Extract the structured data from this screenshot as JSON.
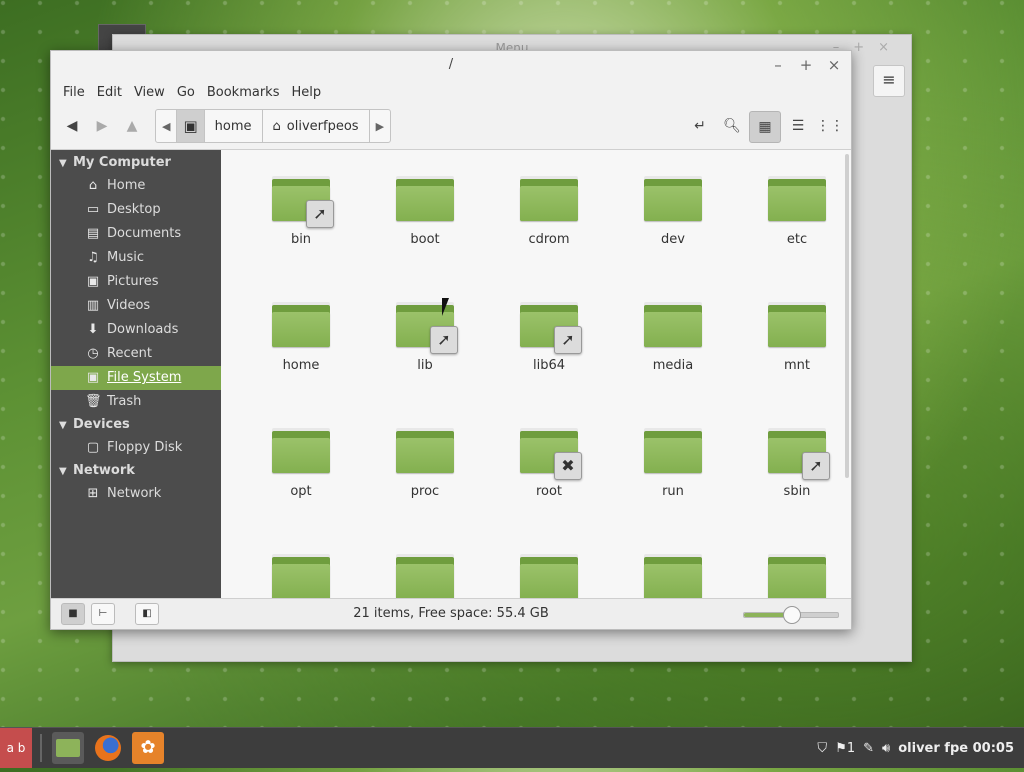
{
  "background_window": {
    "title": "Menu",
    "menu_icon": "hamburger-icon"
  },
  "window": {
    "title": "/",
    "controls": [
      "–",
      "+",
      "×"
    ]
  },
  "menubar": [
    "File",
    "Edit",
    "View",
    "Go",
    "Bookmarks",
    "Help"
  ],
  "toolbar": {
    "breadcrumbs": [
      "home",
      "oliverfpeos"
    ],
    "view_buttons": [
      "icon-view",
      "list-view",
      "compact-view"
    ],
    "active_view": "icon-view"
  },
  "sidebar": {
    "sections": [
      {
        "title": "My Computer",
        "items": [
          {
            "label": "Home",
            "icon": "home-icon"
          },
          {
            "label": "Desktop",
            "icon": "desktop-icon"
          },
          {
            "label": "Documents",
            "icon": "documents-icon"
          },
          {
            "label": "Music",
            "icon": "music-icon"
          },
          {
            "label": "Pictures",
            "icon": "pictures-icon"
          },
          {
            "label": "Videos",
            "icon": "videos-icon"
          },
          {
            "label": "Downloads",
            "icon": "downloads-icon"
          },
          {
            "label": "Recent",
            "icon": "recent-icon"
          },
          {
            "label": "File System",
            "icon": "filesystem-icon",
            "selected": true
          },
          {
            "label": "Trash",
            "icon": "trash-icon"
          }
        ]
      },
      {
        "title": "Devices",
        "items": [
          {
            "label": "Floppy Disk",
            "icon": "floppy-icon"
          }
        ]
      },
      {
        "title": "Network",
        "items": [
          {
            "label": "Network",
            "icon": "network-icon"
          }
        ]
      }
    ]
  },
  "files": [
    {
      "name": "bin",
      "emblem": "symlink"
    },
    {
      "name": "boot",
      "emblem": ""
    },
    {
      "name": "cdrom",
      "emblem": ""
    },
    {
      "name": "dev",
      "emblem": ""
    },
    {
      "name": "etc",
      "emblem": ""
    },
    {
      "name": "home",
      "emblem": ""
    },
    {
      "name": "lib",
      "emblem": "symlink"
    },
    {
      "name": "lib64",
      "emblem": "symlink"
    },
    {
      "name": "media",
      "emblem": ""
    },
    {
      "name": "mnt",
      "emblem": ""
    },
    {
      "name": "opt",
      "emblem": ""
    },
    {
      "name": "proc",
      "emblem": ""
    },
    {
      "name": "root",
      "emblem": "unreadable"
    },
    {
      "name": "run",
      "emblem": ""
    },
    {
      "name": "sbin",
      "emblem": "symlink"
    },
    {
      "name": "",
      "emblem": ""
    },
    {
      "name": "",
      "emblem": ""
    },
    {
      "name": "",
      "emblem": ""
    },
    {
      "name": "",
      "emblem": ""
    },
    {
      "name": "",
      "emblem": ""
    }
  ],
  "statusbar": {
    "text": "21 items, Free space: 55.4 GB",
    "zoom_fraction": 0.5
  },
  "taskbar": {
    "menu_label": "a b",
    "apps": [
      "files-icon",
      "firefox-icon",
      "app-icon"
    ],
    "tray_icons": [
      "shield-icon",
      "updates-icon",
      "pen-icon",
      "volume-icon"
    ],
    "updates_count": "1",
    "user_clock": "oliver fpe 00:05"
  },
  "colors": {
    "accent": "#7ea74b",
    "folder": "#8db35a",
    "sidebar": "#4c4c4c",
    "taskbar": "#3d3d3d"
  }
}
